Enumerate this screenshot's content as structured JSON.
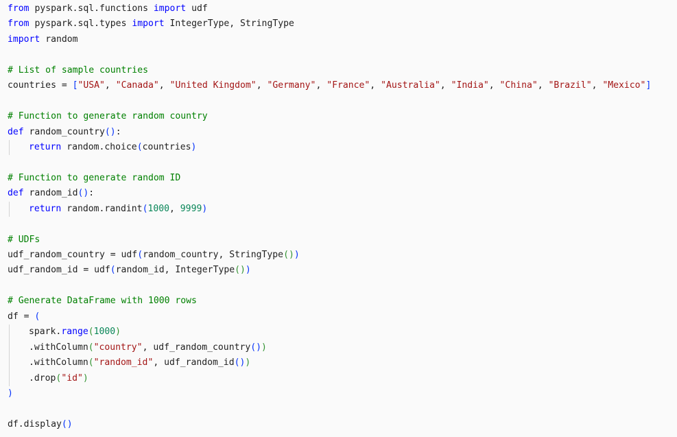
{
  "code": {
    "keywords": {
      "from": "from",
      "import": "import",
      "def": "def",
      "return": "return"
    },
    "l1": {
      "module": "pyspark.sql.functions",
      "name": "udf"
    },
    "l2": {
      "module": "pyspark.sql.types",
      "names": "IntegerType, StringType"
    },
    "l3": {
      "module": "random"
    },
    "l5": {
      "comment": "# List of sample countries"
    },
    "l6": {
      "lhs": "countries = ",
      "countries": [
        "\"USA\"",
        "\"Canada\"",
        "\"United Kingdom\"",
        "\"Germany\"",
        "\"France\"",
        "\"Australia\"",
        "\"India\"",
        "\"China\"",
        "\"Brazil\"",
        "\"Mexico\""
      ]
    },
    "l8": {
      "comment": "# Function to generate random country"
    },
    "l9": {
      "name": "random_country"
    },
    "l10": {
      "call": "random.choice",
      "arg": "countries"
    },
    "l12": {
      "comment": "# Function to generate random ID"
    },
    "l13": {
      "name": "random_id"
    },
    "l14": {
      "call": "random.randint",
      "a": "1000",
      "b": "9999"
    },
    "l16": {
      "comment": "# UDFs"
    },
    "l17": {
      "lhs": "udf_random_country = udf",
      "arg": "random_country, StringType"
    },
    "l18": {
      "lhs": "udf_random_id = udf",
      "arg": "random_id, IntegerType"
    },
    "l20": {
      "comment": "# Generate DataFrame with 1000 rows"
    },
    "l21": {
      "lhs": "df = "
    },
    "l22": {
      "obj": "spark.",
      "method": "range",
      "num": "1000"
    },
    "l23": {
      "method": ".withColumn",
      "str": "\"country\"",
      "rest": ", udf_random_country"
    },
    "l24": {
      "method": ".withColumn",
      "str": "\"random_id\"",
      "rest": ", udf_random_id"
    },
    "l25": {
      "method": ".drop",
      "str": "\"id\""
    },
    "l28": {
      "call": "df.display"
    }
  }
}
